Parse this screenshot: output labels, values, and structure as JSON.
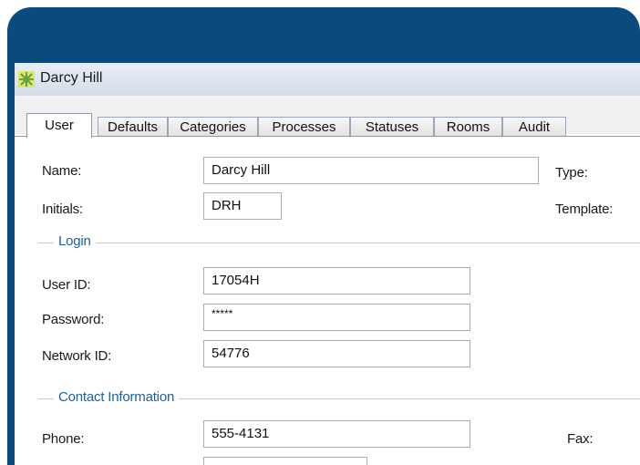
{
  "window": {
    "title": "Darcy Hill",
    "icon": "user-card-icon"
  },
  "tabs": [
    {
      "label": "User",
      "active": true
    },
    {
      "label": "Defaults",
      "active": false
    },
    {
      "label": "Categories",
      "active": false
    },
    {
      "label": "Processes",
      "active": false
    },
    {
      "label": "Statuses",
      "active": false
    },
    {
      "label": "Rooms",
      "active": false
    },
    {
      "label": "Audit",
      "active": false
    }
  ],
  "user_form": {
    "name_label": "Name:",
    "name_value": "Darcy Hill",
    "initials_label": "Initials:",
    "initials_value": "DRH",
    "type_label": "Type:",
    "template_label": "Template:"
  },
  "login": {
    "group_title": "Login",
    "user_id_label": "User ID:",
    "user_id_value": "17054H",
    "password_label": "Password:",
    "password_value": "*****",
    "network_id_label": "Network ID:",
    "network_id_value": "54776"
  },
  "contact": {
    "group_title": "Contact Information",
    "phone_label": "Phone:",
    "phone_value": "555-4131",
    "fax_label": "Fax:"
  },
  "colors": {
    "frame": "#0a4a7f",
    "group_title": "#1f5fa8"
  }
}
